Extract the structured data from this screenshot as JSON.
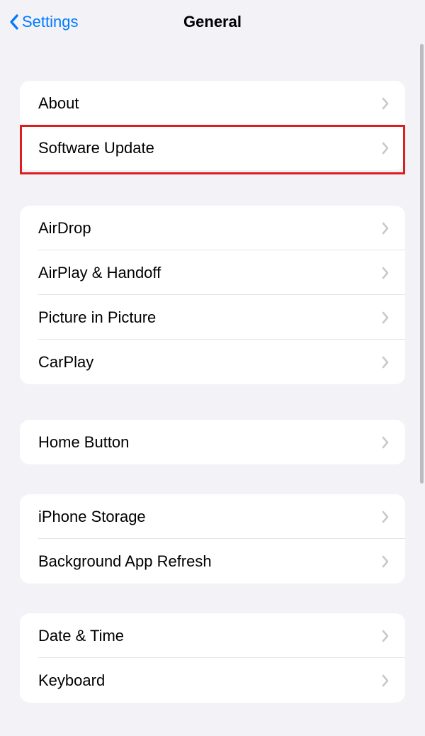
{
  "header": {
    "back_label": "Settings",
    "title": "General"
  },
  "groups": [
    {
      "gap": "normal",
      "items": [
        {
          "id": "about",
          "label": "About"
        },
        {
          "id": "software-update",
          "label": "Software Update"
        }
      ]
    },
    {
      "gap": "normal",
      "items": [
        {
          "id": "airdrop",
          "label": "AirDrop"
        },
        {
          "id": "airplay-handoff",
          "label": "AirPlay & Handoff"
        },
        {
          "id": "picture-in-picture",
          "label": "Picture in Picture"
        },
        {
          "id": "carplay",
          "label": "CarPlay"
        }
      ]
    },
    {
      "gap": "normal",
      "items": [
        {
          "id": "home-button",
          "label": "Home Button"
        }
      ]
    },
    {
      "gap": "small",
      "items": [
        {
          "id": "iphone-storage",
          "label": "iPhone Storage"
        },
        {
          "id": "background-app-refresh",
          "label": "Background App Refresh"
        }
      ]
    },
    {
      "gap": "small",
      "items": [
        {
          "id": "date-time",
          "label": "Date & Time"
        },
        {
          "id": "keyboard",
          "label": "Keyboard"
        }
      ]
    }
  ],
  "highlight": {
    "target": "software-update"
  }
}
